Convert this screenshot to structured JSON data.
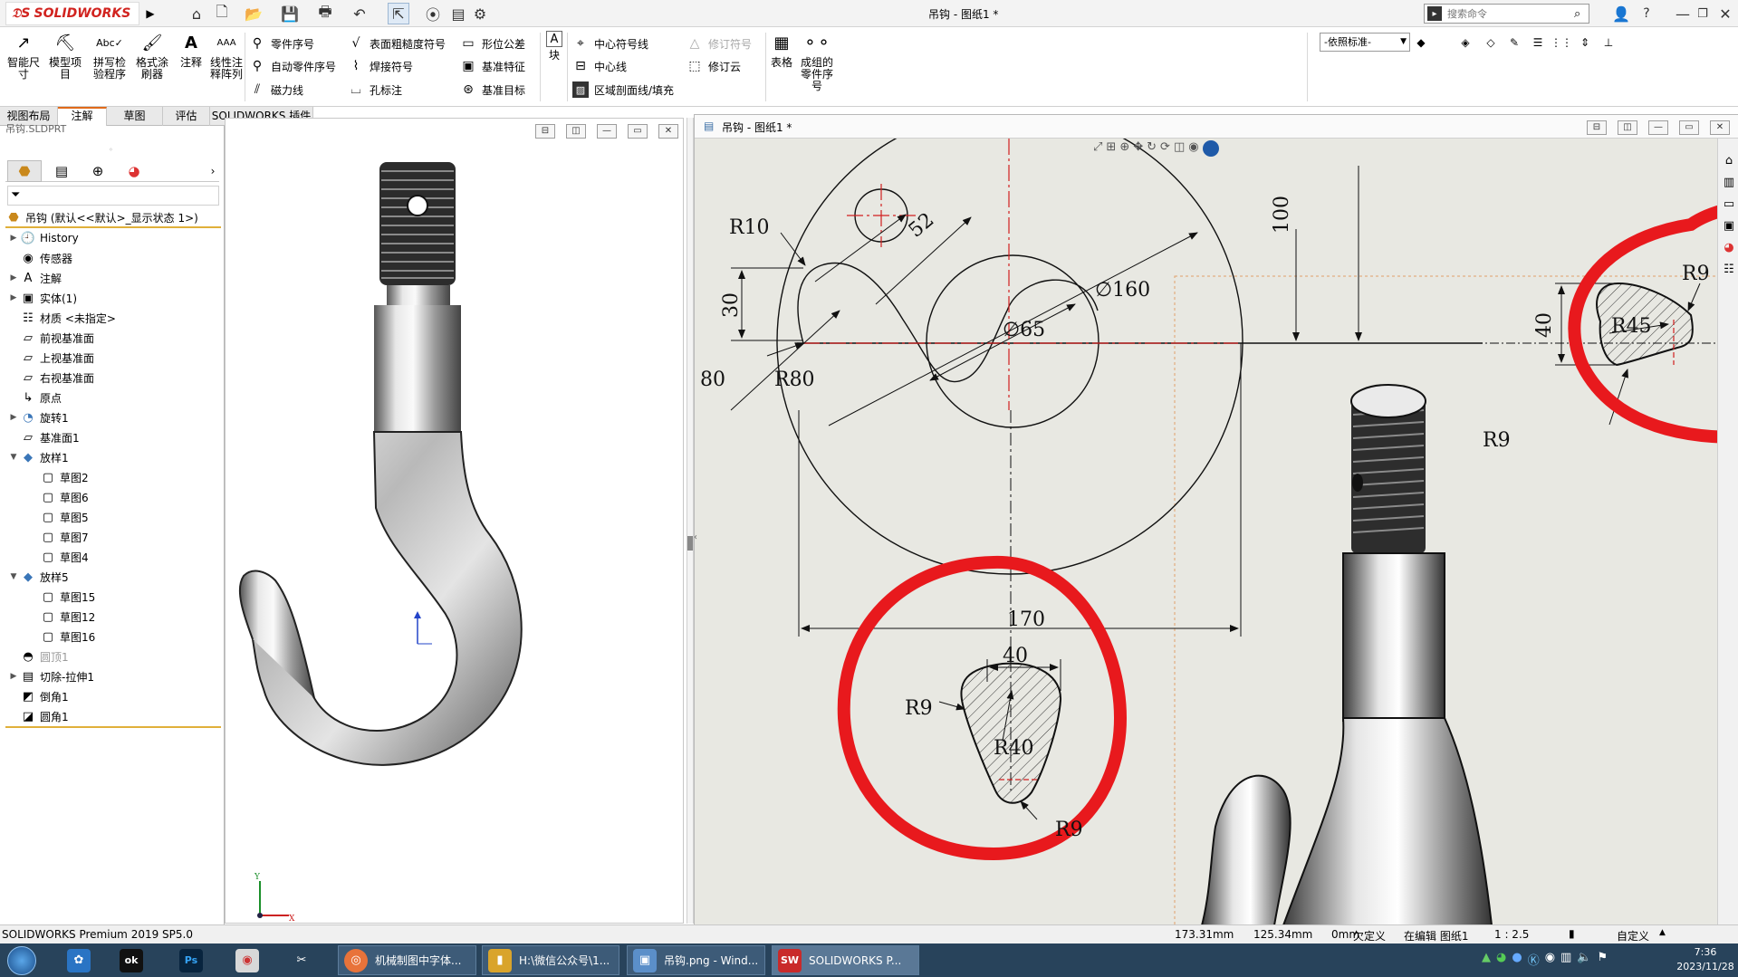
{
  "app": {
    "logo_text": "SOLIDWORKS",
    "document_title": "吊钩 - 图纸1 *",
    "search_placeholder": "搜索命令",
    "help_label": "?"
  },
  "ribbon": {
    "big_buttons": [
      {
        "label1": "智能尺",
        "label2": "寸"
      },
      {
        "label1": "模型项",
        "label2": "目"
      },
      {
        "label1": "拼写检",
        "label2": "验程序"
      },
      {
        "label1": "格式涂",
        "label2": "刷器"
      },
      {
        "label1": "注释",
        "label2": ""
      },
      {
        "label1": "线性注",
        "label2": "释阵列"
      }
    ],
    "col1": [
      "零件序号",
      "自动零件序号",
      "磁力线"
    ],
    "col2": [
      "表面粗糙度符号",
      "焊接符号",
      "孔标注"
    ],
    "col3": [
      "形位公差",
      "基准特征",
      "基准目标"
    ],
    "block_label": "块",
    "col4": [
      "中心符号线",
      "中心线",
      "区域剖面线/填充"
    ],
    "col5": [
      "修订符号",
      "修订云"
    ],
    "table_label": "表格",
    "bom_label1": "成组的",
    "bom_label2": "零件序",
    "bom_label3": "号",
    "layer_select": "-依照标准-"
  },
  "tabs": [
    "视图布局",
    "注解",
    "草图",
    "评估",
    "SOLIDWORKS 插件"
  ],
  "feature_tree": {
    "header_file": "吊钩.SLDPRT",
    "root": "吊钩  (默认<<默认>_显示状态 1>)",
    "items": [
      {
        "label": "History",
        "expand": "▶",
        "indent": 0,
        "icon": "history-icon"
      },
      {
        "label": "传感器",
        "expand": "",
        "indent": 0,
        "icon": "sensor-icon"
      },
      {
        "label": "注解",
        "expand": "▶",
        "indent": 0,
        "icon": "annotation-icon"
      },
      {
        "label": "实体(1)",
        "expand": "▶",
        "indent": 0,
        "icon": "solid-body-icon"
      },
      {
        "label": "材质 <未指定>",
        "expand": "",
        "indent": 0,
        "icon": "material-icon"
      },
      {
        "label": "前视基准面",
        "expand": "",
        "indent": 0,
        "icon": "plane-icon"
      },
      {
        "label": "上视基准面",
        "expand": "",
        "indent": 0,
        "icon": "plane-icon"
      },
      {
        "label": "右视基准面",
        "expand": "",
        "indent": 0,
        "icon": "plane-icon"
      },
      {
        "label": "原点",
        "expand": "",
        "indent": 0,
        "icon": "origin-icon"
      },
      {
        "label": "旋转1",
        "expand": "▶",
        "indent": 0,
        "icon": "revolve-icon"
      },
      {
        "label": "基准面1",
        "expand": "",
        "indent": 0,
        "icon": "plane-icon"
      },
      {
        "label": "放样1",
        "expand": "▼",
        "indent": 0,
        "icon": "loft-icon"
      },
      {
        "label": "草图2",
        "expand": "",
        "indent": 1,
        "icon": "sketch-icon"
      },
      {
        "label": "草图6",
        "expand": "",
        "indent": 1,
        "icon": "sketch-icon"
      },
      {
        "label": "草图5",
        "expand": "",
        "indent": 1,
        "icon": "sketch-icon"
      },
      {
        "label": "草图7",
        "expand": "",
        "indent": 1,
        "icon": "sketch-icon"
      },
      {
        "label": "草图4",
        "expand": "",
        "indent": 1,
        "icon": "sketch-icon"
      },
      {
        "label": "放样5",
        "expand": "▼",
        "indent": 0,
        "icon": "loft-icon"
      },
      {
        "label": "草图15",
        "expand": "",
        "indent": 1,
        "icon": "sketch-icon"
      },
      {
        "label": "草图12",
        "expand": "",
        "indent": 1,
        "icon": "sketch-icon"
      },
      {
        "label": "草图16",
        "expand": "",
        "indent": 1,
        "icon": "sketch-icon"
      },
      {
        "label": "圆顶1",
        "expand": "",
        "indent": 0,
        "icon": "dome-icon",
        "muted": true
      },
      {
        "label": "切除-拉伸1",
        "expand": "▶",
        "indent": 0,
        "icon": "cut-extrude-icon"
      },
      {
        "label": "倒角1",
        "expand": "",
        "indent": 0,
        "icon": "chamfer-icon"
      },
      {
        "label": "圆角1",
        "expand": "",
        "indent": 0,
        "icon": "fillet-icon"
      }
    ]
  },
  "drawing": {
    "window_title": "吊钩 - 图纸1 *",
    "dims": {
      "r10": "R10",
      "d52": "52",
      "d100": "100",
      "r9_top": "R9",
      "d30": "30",
      "d160": "∅160",
      "d65": "∅65",
      "r45": "R45",
      "d40_right": "40",
      "d80": "80",
      "r80": "R80",
      "r9_right": "R9",
      "d170": "170",
      "d40_bottom": "40",
      "r9_bl": "R9",
      "r40": "R40",
      "r9_br": "R9"
    }
  },
  "status": {
    "product": "SOLIDWORKS Premium 2019 SP5.0",
    "x": "173.31mm",
    "y": "125.34mm",
    "z": "0mm",
    "defined": "欠定义",
    "editing": "在编辑 图纸1",
    "scale": "1 : 2.5",
    "custom": "自定义"
  },
  "taskbar": {
    "items": [
      {
        "label": "机械制图中字体...",
        "color": "#e8733a"
      },
      {
        "label": "H:\\微信公众号\\1...",
        "color": "#d9a42b"
      },
      {
        "label": "吊钩.png - Wind...",
        "color": "#5b8fc9"
      },
      {
        "label": "SOLIDWORKS P...",
        "color": "#c92a2a"
      }
    ],
    "time": "7:36",
    "date": "2023/11/28"
  },
  "colors": {
    "accent": "#e06a1a",
    "taskbar": "#28435b",
    "markup_red": "#e8191d",
    "centerline_red": "#d21f1f"
  }
}
